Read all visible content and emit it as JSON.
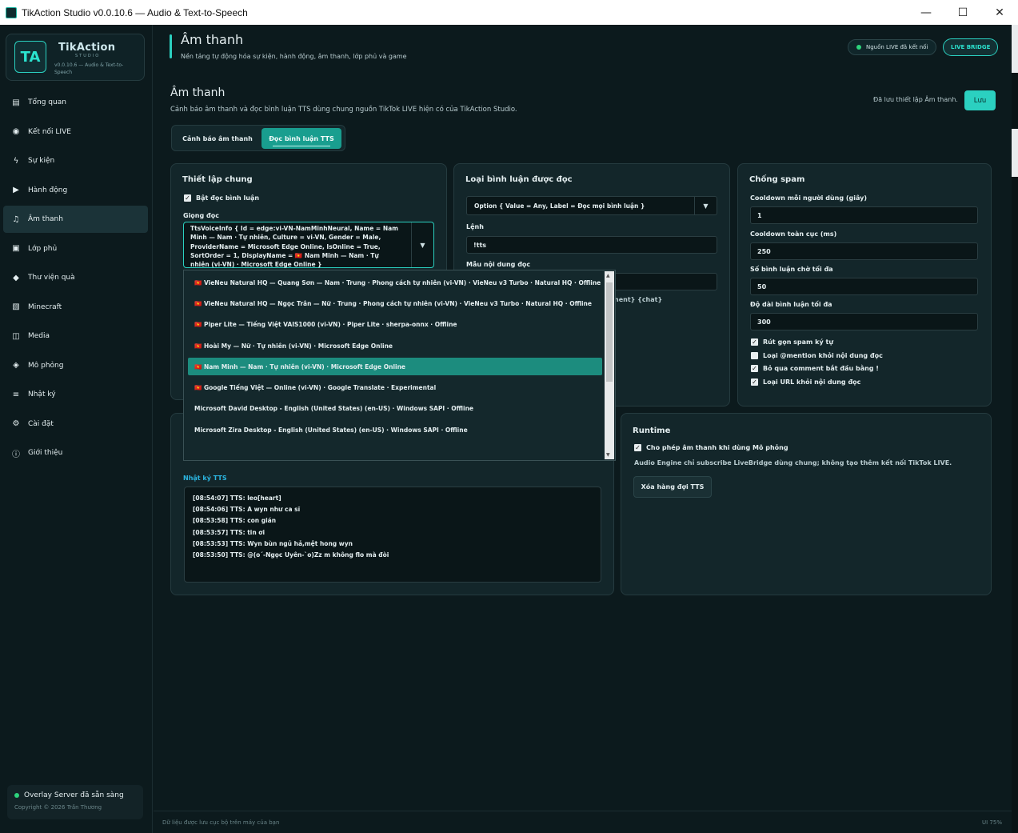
{
  "window": {
    "title": "TikAction Studio v0.0.10.6 — Audio & Text-to-Speech",
    "minimize": "—",
    "maximize": "☐",
    "close": "✕"
  },
  "brand": {
    "name": "TikAction",
    "sub": "STUDIO",
    "version": "v0.0.10.6 — Audio & Text-to-Speech",
    "mark": "TA"
  },
  "nav": [
    {
      "label": "Tổng quan",
      "icon": "▤"
    },
    {
      "label": "Kết nối LIVE",
      "icon": "◉"
    },
    {
      "label": "Sự kiện",
      "icon": "ϟ"
    },
    {
      "label": "Hành động",
      "icon": "▶"
    },
    {
      "label": "Âm thanh",
      "icon": "♫"
    },
    {
      "label": "Lớp phủ",
      "icon": "▣"
    },
    {
      "label": "Thư viện quà",
      "icon": "◆"
    },
    {
      "label": "Minecraft",
      "icon": "▧"
    },
    {
      "label": "Media",
      "icon": "◫"
    },
    {
      "label": "Mô phỏng",
      "icon": "◈"
    },
    {
      "label": "Nhật ký",
      "icon": "≡"
    },
    {
      "label": "Cài đặt",
      "icon": "⚙"
    },
    {
      "label": "Giới thiệu",
      "icon": "ⓘ"
    }
  ],
  "server": {
    "status": "Overlay Server đã sẵn sàng",
    "copyright": "Copyright © 2026 Trần Thương"
  },
  "header": {
    "title": "Âm thanh",
    "subtitle": "Nền tảng tự động hóa sự kiện, hành động, âm thanh, lớp phủ và game",
    "live_status": "Nguồn LIVE đã kết nối",
    "bridge": "LIVE BRIDGE"
  },
  "section": {
    "title": "Âm thanh",
    "subtitle": "Cảnh báo âm thanh và đọc bình luận TTS dùng chung nguồn TikTok LIVE hiện có của TikAction Studio.",
    "saved": "Đã lưu thiết lập Âm thanh.",
    "save": "Lưu"
  },
  "tabs": [
    "Cảnh báo âm thanh",
    "Đọc bình luận TTS"
  ],
  "general": {
    "title": "Thiết lập chung",
    "enable_label": "Bật đọc bình luận",
    "voice_label": "Giọng đọc",
    "voice_value": "TtsVoiceInfo { Id = edge:vi-VN-NamMinhNeural, Name = Nam Minh — Nam · Tự nhiên, Culture = vi-VN, Gender = Male, ProviderName = Microsoft Edge Online, IsOnline = True, SortOrder = 1, DisplayName = 🇻🇳 Nam Minh — Nam · Tự nhiên (vi-VN) · Microsoft Edge Online }"
  },
  "voice_options": [
    "🇻🇳 VieNeu Natural HQ — Quang Sơn — Nam · Trung · Phong cách tự nhiên (vi-VN) · VieNeu v3 Turbo · Natural HQ · Offline",
    "🇻🇳 VieNeu Natural HQ — Ngọc Trân — Nữ · Trung · Phong cách tự nhiên (vi-VN) · VieNeu v3 Turbo · Natural HQ · Offline",
    "🇻🇳 Piper Lite — Tiếng Việt VAIS1000 (vi-VN) · Piper Lite · sherpa-onnx · Offline",
    "🇻🇳 Hoài My — Nữ · Tự nhiên (vi-VN) · Microsoft Edge Online",
    "🇻🇳 Nam Minh — Nam · Tự nhiên (vi-VN) · Microsoft Edge Online",
    "🇻🇳 Google Tiếng Việt — Online (vi-VN) · Google Translate · Experimental",
    "Microsoft David Desktop - English (United States) (en-US) · Windows SAPI · Offline",
    "Microsoft Zira Desktop - English (United States) (en-US) · Windows SAPI · Offline"
  ],
  "comment_type": {
    "title": "Loại bình luận được đọc",
    "select_value": "Option { Value = Any, Label = Đọc mọi bình luận }",
    "command_label": "Lệnh",
    "command_value": "!tts",
    "template_label": "Mẫu nội dung đọc",
    "template_hint": "nent} {chat}"
  },
  "spam": {
    "title": "Chống spam",
    "cooldown_user_label": "Cooldown mỗi người dùng (giây)",
    "cooldown_user": "1",
    "cooldown_global_label": "Cooldown toàn cục (ms)",
    "cooldown_global": "250",
    "max_queue_label": "Số bình luận chờ tối đa",
    "max_queue": "50",
    "max_len_label": "Độ dài bình luận tối đa",
    "max_len": "300",
    "checks": [
      {
        "label": "Rút gọn spam ký tự",
        "checked": true
      },
      {
        "label": "Loại @mention khỏi nội dung đọc",
        "checked": false
      },
      {
        "label": "Bỏ qua comment bắt đầu bằng !",
        "checked": true
      },
      {
        "label": "Loại URL khỏi nội dung đọc",
        "checked": true
      }
    ]
  },
  "log": {
    "title": "Nhật ký TTS",
    "lines": [
      "[08:54:07] TTS: leo[heart]",
      "[08:54:06] TTS: A wyn như ca sĩ",
      "[08:53:58] TTS: con gián",
      "[08:53:57] TTS: tin ơi",
      "[08:53:53] TTS: Wyn bùn ngủ hả,mệt hong wyn",
      "[08:53:50] TTS: @(o´-Ngọc Uyên-`o)Zz m không flo mà đòi"
    ]
  },
  "runtime": {
    "title": "Runtime",
    "allow_label": "Cho phép âm thanh khi dùng Mô phỏng",
    "note": "Audio Engine chỉ subscribe LiveBridge dùng chung; không tạo thêm kết nối TikTok LIVE.",
    "clear_btn": "Xóa hàng đợi TTS"
  },
  "footer": {
    "left": "Dữ liệu được lưu cục bộ trên máy của bạn",
    "right": "UI 75%"
  },
  "colors": {
    "accent": "#2bd0c0",
    "bg": "#0c1a1d",
    "card": "#13262a",
    "selected": "#1c8c7e"
  }
}
